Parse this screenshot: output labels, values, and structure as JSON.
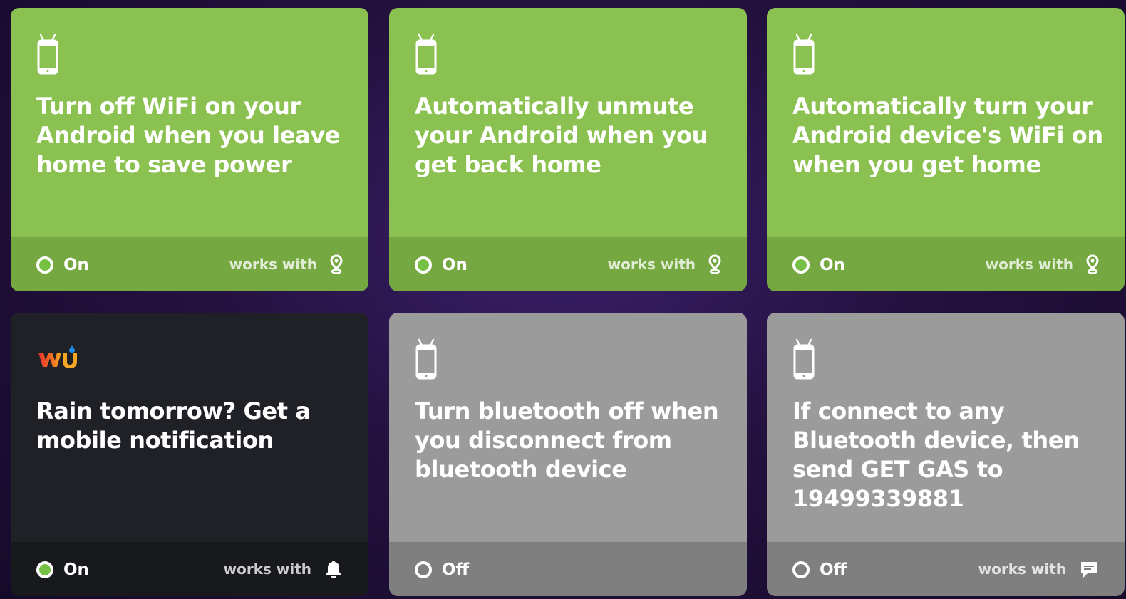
{
  "applets": [
    {
      "title": "Turn off WiFi on your Android when you leave home to save power",
      "service_icon": "android-phone-icon",
      "status": "On",
      "works_with_label": "works with",
      "works_with_icon": "location-pin-icon",
      "theme": "green"
    },
    {
      "title": "Automatically unmute your Android when you get back home",
      "service_icon": "android-phone-icon",
      "status": "On",
      "works_with_label": "works with",
      "works_with_icon": "location-pin-icon",
      "theme": "green"
    },
    {
      "title": "Automatically turn your Android device's WiFi on when you get home",
      "service_icon": "android-phone-icon",
      "status": "On",
      "works_with_label": "works with",
      "works_with_icon": "location-pin-icon",
      "theme": "green"
    },
    {
      "title": "Rain tomorrow? Get a mobile notification",
      "service_icon": "weather-underground-logo",
      "status": "On",
      "works_with_label": "works with",
      "works_with_icon": "notification-bell-icon",
      "theme": "dark"
    },
    {
      "title": "Turn bluetooth off when you disconnect from bluetooth device",
      "service_icon": "android-phone-icon",
      "status": "Off",
      "works_with_label": "",
      "works_with_icon": "",
      "theme": "gray"
    },
    {
      "title": "If connect to any Bluetooth device, then send GET GAS to 19499339881",
      "service_icon": "android-phone-icon",
      "status": "Off",
      "works_with_label": "works with",
      "works_with_icon": "sms-message-icon",
      "theme": "gray"
    }
  ],
  "colors": {
    "green_top": "#8bc151",
    "green_bottom": "#76a842",
    "dark_top": "#1f2126",
    "dark_bottom": "#17191d",
    "gray_top": "#9b9b9b",
    "gray_bottom": "#7f7f7f",
    "on_dot": "#76c043"
  }
}
